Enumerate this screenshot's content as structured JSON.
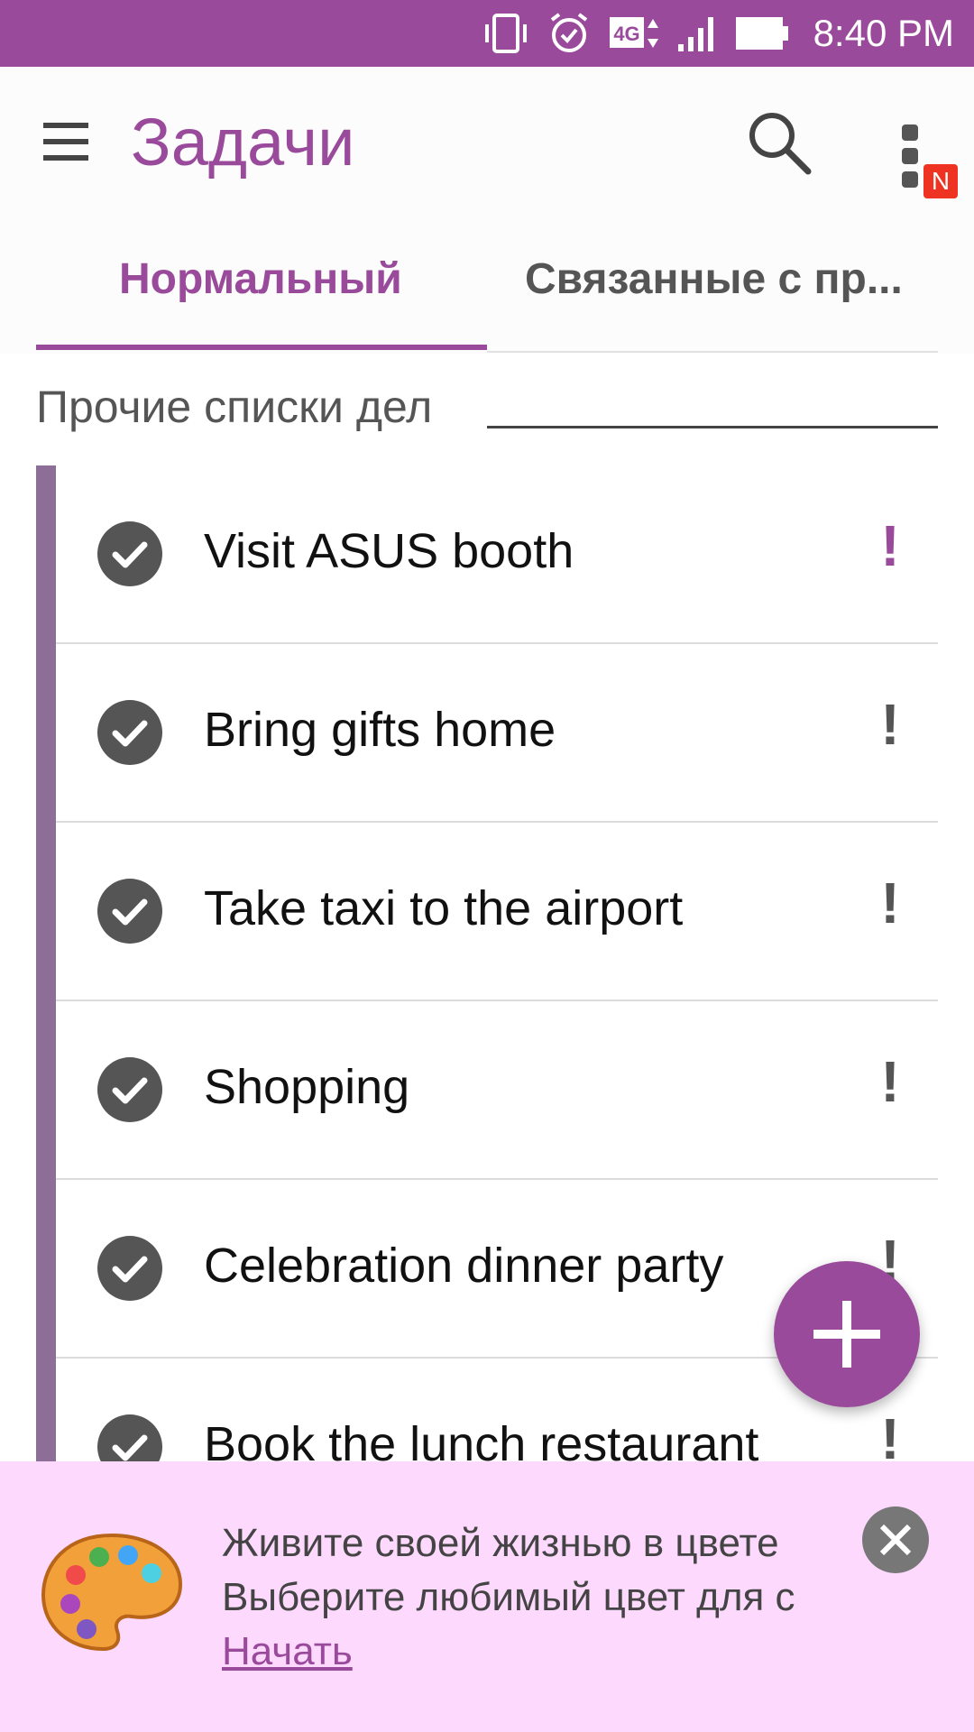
{
  "status_bar": {
    "network": "4G",
    "time": "8:40 PM",
    "icons": [
      "vibrate-icon",
      "alarm-icon",
      "network-4g-icon",
      "signal-icon",
      "battery-icon"
    ]
  },
  "app_bar": {
    "title": "Задачи",
    "badge": "N",
    "icons": [
      "menu-icon",
      "search-icon",
      "more-vert-icon"
    ]
  },
  "tabs": [
    {
      "label": "Нормальный",
      "selected": true
    },
    {
      "label": "Связанные с пр...",
      "selected": false
    }
  ],
  "section": {
    "title": "Прочие списки дел"
  },
  "tasks": [
    {
      "title": "Visit ASUS booth",
      "importance_color": "#9a4a9b"
    },
    {
      "title": "Bring gifts home",
      "importance_color": "#555555"
    },
    {
      "title": "Take taxi to the airport",
      "importance_color": "#555555"
    },
    {
      "title": "Shopping",
      "importance_color": "#555555"
    },
    {
      "title": "Celebration dinner party",
      "importance_color": "#555555"
    },
    {
      "title": "Book the lunch restaurant",
      "importance_color": "#555555"
    }
  ],
  "fab": {
    "icon": "plus-icon"
  },
  "banner": {
    "title": "Живите своей жизнью в цвете",
    "text": "Выберите любимый цвет для с",
    "link": "Начать",
    "icons": [
      "palette-icon",
      "close-icon"
    ]
  },
  "colors": {
    "accent": "#9a4a9b",
    "banner_bg": "#fed9fe",
    "task_bar": "#8d6e96"
  }
}
